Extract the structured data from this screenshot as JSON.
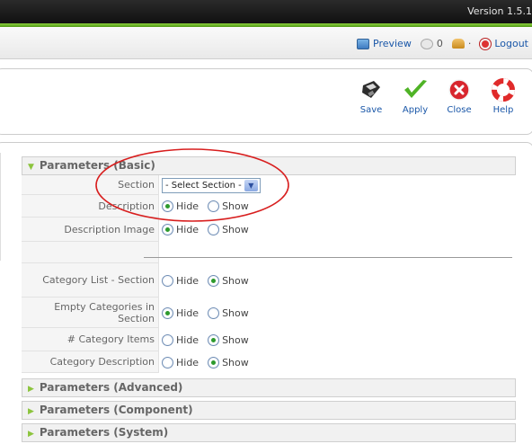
{
  "header": {
    "version": "Version 1.5.1"
  },
  "status": {
    "preview_label": "Preview",
    "messages_count": "0",
    "users_count": "·",
    "logout_label": "Logout"
  },
  "toolbar": {
    "save_label": "Save",
    "apply_label": "Apply",
    "close_label": "Close",
    "help_label": "Help"
  },
  "params": {
    "basic_title": "Parameters (Basic)",
    "advanced_title": "Parameters (Advanced)",
    "component_title": "Parameters (Component)",
    "system_title": "Parameters (System)",
    "hide_label": "Hide",
    "show_label": "Show",
    "rows": [
      {
        "label": "Section",
        "select_value": "- Select Section -"
      },
      {
        "label": "Description",
        "selected": "hide"
      },
      {
        "label": "Description Image",
        "selected": "hide"
      },
      {
        "label": "Category List - Section",
        "selected": "show"
      },
      {
        "label": "Empty Categories in Section",
        "selected": "hide"
      },
      {
        "label": "# Category Items",
        "selected": "show"
      },
      {
        "label": "Category Description",
        "selected": "show"
      }
    ]
  },
  "colors": {
    "accent_green": "#6fb82a",
    "link_blue": "#1a57a8",
    "annotation_red": "#d81e1e"
  }
}
